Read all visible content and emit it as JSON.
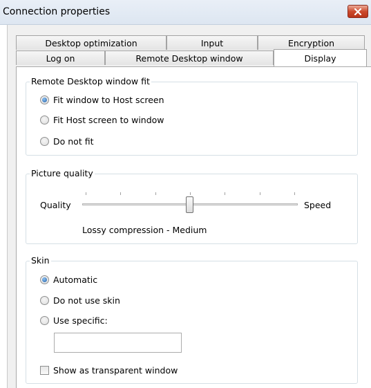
{
  "window": {
    "title": "Connection properties",
    "close_icon": "close-icon"
  },
  "tabs": {
    "row_back": [
      "Desktop optimization",
      "Input",
      "Encryption"
    ],
    "row_front": [
      "Log on",
      "Remote Desktop window",
      "Display"
    ],
    "active": "Display"
  },
  "fit_group": {
    "title": "Remote Desktop window fit",
    "options": [
      "Fit window to Host screen",
      "Fit Host screen to window",
      "Do not fit"
    ],
    "selected": "Fit window to Host screen"
  },
  "quality_group": {
    "title": "Picture quality",
    "left_label": "Quality",
    "right_label": "Speed",
    "status": "Lossy compression - Medium",
    "tick_count": 7,
    "level_fraction": 0.5
  },
  "skin_group": {
    "title": "Skin",
    "options": [
      "Automatic",
      "Do not use skin",
      "Use specific:"
    ],
    "selected": "Automatic",
    "specific_value": "",
    "transparent_label": "Show as transparent window",
    "transparent_checked": false
  },
  "colors": {
    "accent": "#1f5fa8",
    "close_button": "#cc4a2d"
  }
}
